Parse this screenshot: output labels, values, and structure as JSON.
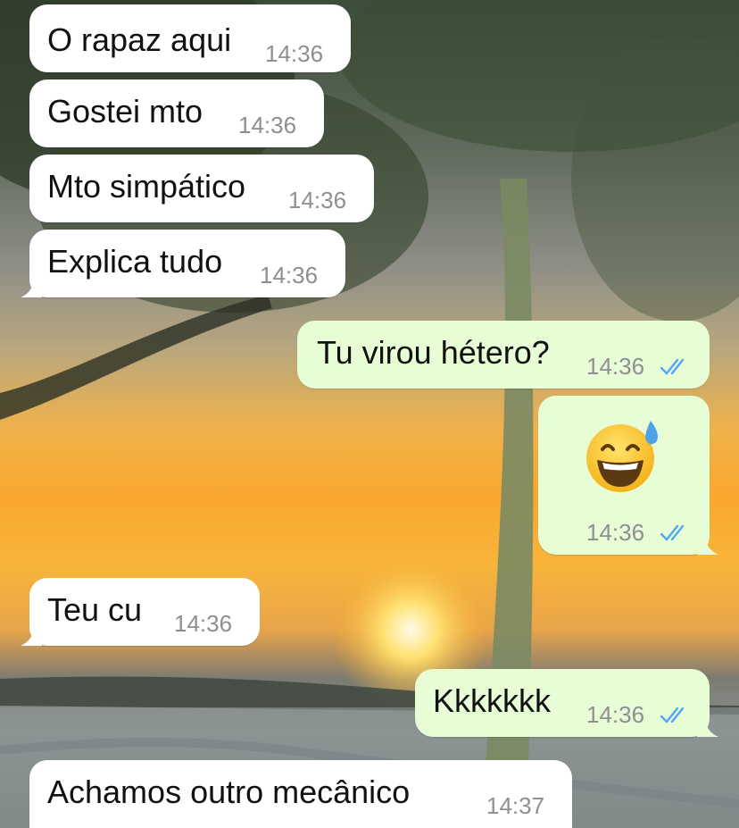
{
  "messages": [
    {
      "text": "O rapaz aqui",
      "time": "14:36",
      "direction": "in"
    },
    {
      "text": "Gostei mto",
      "time": "14:36",
      "direction": "in"
    },
    {
      "text": "Mto simpático",
      "time": "14:36",
      "direction": "in"
    },
    {
      "text": "Explica tudo",
      "time": "14:36",
      "direction": "in"
    },
    {
      "text": "Tu virou hétero?",
      "time": "14:36",
      "direction": "out",
      "status": "read"
    },
    {
      "emoji": "grinning-face-with-sweat-icon",
      "time": "14:36",
      "direction": "out",
      "status": "read"
    },
    {
      "text": "Teu cu",
      "time": "14:36",
      "direction": "in"
    },
    {
      "text": "Kkkkkkk",
      "time": "14:36",
      "direction": "out",
      "status": "read"
    },
    {
      "text": "Achamos outro mecânico",
      "time": "14:37",
      "direction": "in"
    }
  ],
  "colors": {
    "incoming_bubble": "#ffffff",
    "outgoing_bubble": "#e7fdd5",
    "read_ticks": "#4fa6f5",
    "timestamp": "#8e8e93"
  }
}
